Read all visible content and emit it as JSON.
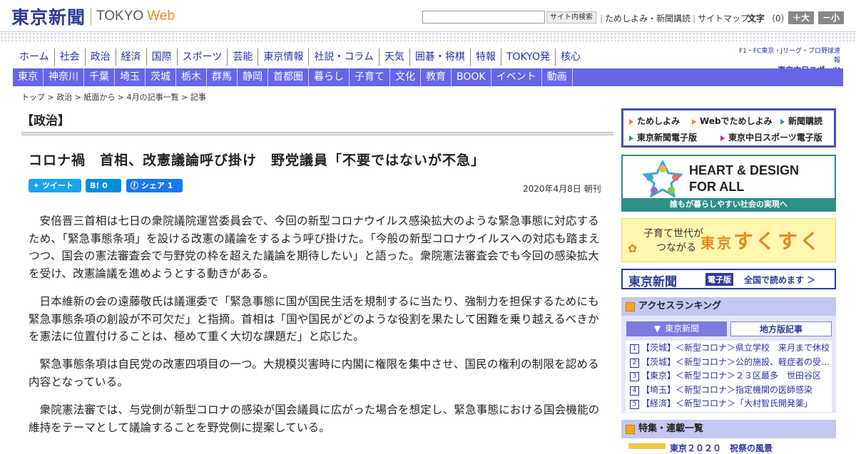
{
  "header": {
    "logo_jp": "東京新聞",
    "logo_tokyo": "TOKYO",
    "logo_web": "Web",
    "search_button": "サイト内検索",
    "links": [
      "ためしよみ・新聞講読",
      "サイトマップ"
    ],
    "font_label": "文字",
    "font_count": "（0）",
    "font_plus": "＋大",
    "font_minus": "－小"
  },
  "nav_primary": [
    "ホーム",
    "社会",
    "政治",
    "経済",
    "国際",
    "スポーツ",
    "芸能",
    "東京情報",
    "社説・コラム",
    "天気",
    "囲碁・将棋",
    "特報",
    "TOKYO発",
    "核心"
  ],
  "sports_link": {
    "line1": "F1・FC東京・Jリーグ・プロ野球速報",
    "line2": "東京中日スポーツ"
  },
  "nav_regional": [
    "東京",
    "神奈川",
    "千葉",
    "埼玉",
    "茨城",
    "栃木",
    "群馬",
    "静岡",
    "首都圏",
    "暮らし",
    "子育て",
    "文化",
    "教育",
    "BOOK",
    "イベント",
    "動画"
  ],
  "breadcrumb": "トップ > 政治 > 紙面から > 4月の記事一覧 > 記事",
  "article": {
    "section": "【政治】",
    "headline": "コロナ禍　首相、改憲議論呼び掛け　野党議員「不要ではないが不急」",
    "share": {
      "tweet": "ツイート",
      "hatena": "B!  0",
      "facebook": "シェア 1"
    },
    "date": "2020年4月8日 朝刊",
    "paragraphs": [
      "安倍晋三首相は七日の衆院議院運営委員会で、今回の新型コロナウイルス感染拡大のような緊急事態に対応するため、「緊急事態条項」を設ける改憲の議論をするよう呼び掛けた。「今般の新型コロナウイルスへの対応も踏まえつつ、国会の憲法審査会で与野党の枠を超えた議論を期待したい」と語った。衆院憲法審査会でも今回の感染拡大を受け、改憲論議を進めようとする動きがある。",
      "日本維新の会の遠藤敬氏は議運委で「緊急事態に国が国民生活を規制するに当たり、強制力を担保するためにも緊急事態条項の創設が不可欠だ」と指摘。首相は「国や国民がどのような役割を果たして困難を乗り越えるべきかを憲法に位置付けることは、極めて重く大切な課題だ」と応じた。",
      "緊急事態条項は自民党の改憲四項目の一つ。大規模災害時に内閣に権限を集中させ、国民の権利の制限を認める内容となっている。",
      "衆院憲法審では、与党側が新型コロナの感染が国会議員に広がった場合を想定し、緊急事態における国会機能の維持をテーマとして議論することを野党側に提案している。"
    ]
  },
  "sidebar": {
    "links": [
      "ためしよみ",
      "Webでためしよみ",
      "新聞購読",
      "東京新聞電子版",
      "東京中日スポーツ電子版"
    ],
    "heart_banner": {
      "line1": "HEART & DESIGN",
      "line2": "FOR ALL",
      "bottom": "誰もが暮らしやすい社会の実現へ"
    },
    "sukusuku": {
      "line1": "子育て世代が",
      "line2": "つながる",
      "tokyo": "東京",
      "name": "すくすく"
    },
    "epaper": {
      "name": "東京新聞",
      "badge": "電子版",
      "text": "全国で読めます ＞"
    },
    "ranking": {
      "title": "アクセスランキング",
      "tab_tokyo": "東京新聞",
      "tab_local": "地方版記事",
      "items": [
        {
          "num": "1",
          "text": "【茨城】＜新型コロナ＞県立学校　来月まで休校"
        },
        {
          "num": "2",
          "text": "【茨城】＜新型コロナ＞公的施設、軽症者の受け入れ"
        },
        {
          "num": "3",
          "text": "【東京】＜新型コロナ＞２３区最多　世田谷区"
        },
        {
          "num": "4",
          "text": "【埼玉】＜新型コロナ＞指定機関の医師感染"
        },
        {
          "num": "5",
          "text": "【経済】＜新型コロナ＞「大村智氏開発薬」"
        }
      ]
    },
    "feature": {
      "title": "特集・連載一覧",
      "first_item": "東京２０２０　祝祭の風景"
    }
  },
  "colors": {
    "brand": "#2f3a9b",
    "nav_bar": "#6764e8",
    "accent": "#e8891b",
    "heart": "#2e8f86"
  }
}
